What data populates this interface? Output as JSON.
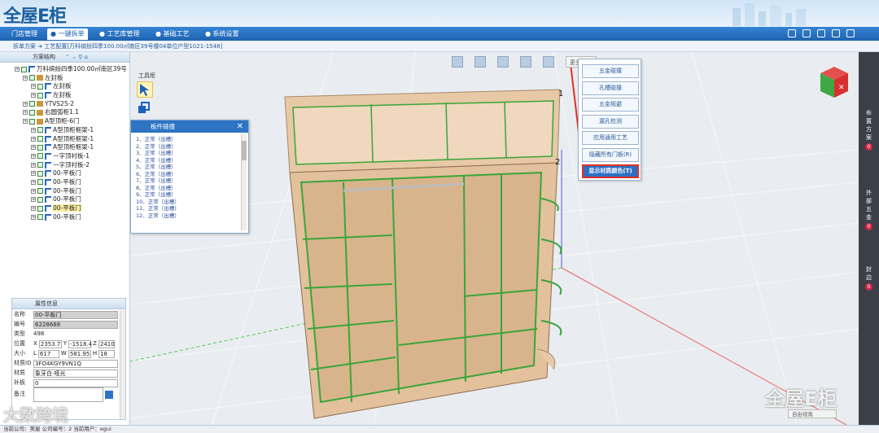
{
  "header": {
    "logo_text": "全屋E柜"
  },
  "nav": {
    "tabs": [
      {
        "label": "门店管理"
      },
      {
        "label": "一键拆单"
      },
      {
        "label": "工艺库管理"
      },
      {
        "label": "基础工艺"
      },
      {
        "label": "系统设置"
      }
    ]
  },
  "breadcrumb": "拆单方案 ➔ 工艺配置[万科缤纷四季100.00㎡南区39号楼04单位户型1021-1548]",
  "scheme_panel": {
    "title": "方案结构"
  },
  "tree": [
    {
      "level": 0,
      "label": "万科缤纷四季100.00㎡南区39号",
      "icon": "part-icon"
    },
    {
      "level": 1,
      "label": "左封板",
      "icon": "folder-icon"
    },
    {
      "level": 2,
      "label": "左封板",
      "icon": "part-icon"
    },
    {
      "level": 2,
      "label": "左封板",
      "icon": "part-icon"
    },
    {
      "level": 1,
      "label": "YTVS25-2",
      "icon": "folder-icon"
    },
    {
      "level": 1,
      "label": "右圆弧柜1.1",
      "icon": "folder-icon"
    },
    {
      "level": 1,
      "label": "A型顶柜-6门",
      "icon": "folder-icon"
    },
    {
      "level": 2,
      "label": "A型顶柜框架-1",
      "icon": "part-icon"
    },
    {
      "level": 2,
      "label": "A型顶柜框架-1",
      "icon": "part-icon"
    },
    {
      "level": 2,
      "label": "A型顶柜框架-1",
      "icon": "part-icon"
    },
    {
      "level": 2,
      "label": "一字顶衬板-1",
      "icon": "part-icon"
    },
    {
      "level": 2,
      "label": "一字顶衬板-2",
      "icon": "part-icon"
    },
    {
      "level": 2,
      "label": "00-平板门",
      "icon": "part-icon"
    },
    {
      "level": 2,
      "label": "00-平板门",
      "icon": "part-icon"
    },
    {
      "level": 2,
      "label": "00-平板门",
      "icon": "part-icon"
    },
    {
      "level": 2,
      "label": "00-平板门",
      "icon": "part-icon"
    },
    {
      "level": 2,
      "label": "00-平板门",
      "icon": "part-icon",
      "selected": true
    },
    {
      "level": 2,
      "label": "00-平板门",
      "icon": "part-icon"
    }
  ],
  "properties": {
    "title": "属性信息",
    "name_label": "名称",
    "name": "00-平板门",
    "code_label": "编号",
    "code": "6228688",
    "type_label": "类型",
    "type": "498",
    "pos_label": "位置",
    "x_label": "X",
    "x": "2353.7",
    "y_label": "Y",
    "y": "-1518.4",
    "z_label": "Z",
    "z": "2410",
    "size_label": "大小",
    "l_label": "L",
    "l": "617",
    "w_label": "W",
    "w": "581.95",
    "h_label": "H",
    "h": "18",
    "matid_label": "材质ID",
    "matid": "3FO4KGY9VN1Q",
    "material_label": "材质",
    "material": "象牙白-哑光",
    "patch_label": "补板",
    "patch": "0",
    "remark_label": "备注"
  },
  "footer": "当前公司：美屋  公司编号：2  当前用户：egui",
  "viewport": {
    "toolbox_label": "工具柜",
    "more_button": "更多工具",
    "annotation_1": "1",
    "annotation_2": "2",
    "view_button": "自由视角"
  },
  "board_collision": {
    "title": "板件碰撞",
    "items": [
      "1、正常（出槽）",
      "2、正常（出槽）",
      "3、正常（出槽）",
      "4、正常（出槽）",
      "5、正常（出槽）",
      "6、正常（出槽）",
      "7、正常（出槽）",
      "8、正常（出槽）",
      "9、正常（出槽）",
      "10、正常（出槽）",
      "11、正常（出槽）",
      "12、正常（出槽）"
    ]
  },
  "context_menu": {
    "items": [
      "五金碰撞",
      "孔槽碰撞",
      "五金规避",
      "漏孔检测",
      "应用通用工艺",
      "隐藏所有门板(R)",
      "显示材质颜色(T)"
    ]
  },
  "right_bar": {
    "items": [
      {
        "label": "布置方案",
        "badge": "0"
      },
      {
        "label": "外部五金",
        "badge": "0"
      },
      {
        "label": "封边",
        "badge": "0"
      }
    ]
  },
  "watermarks": {
    "left": "大数跨境",
    "right": "全屋E柜"
  },
  "colors": {
    "nav_blue": "#1e63b0",
    "highlight_red": "#e03026",
    "cabinet_wood": "#e7c9a6",
    "edge_green": "#3aa53a"
  }
}
